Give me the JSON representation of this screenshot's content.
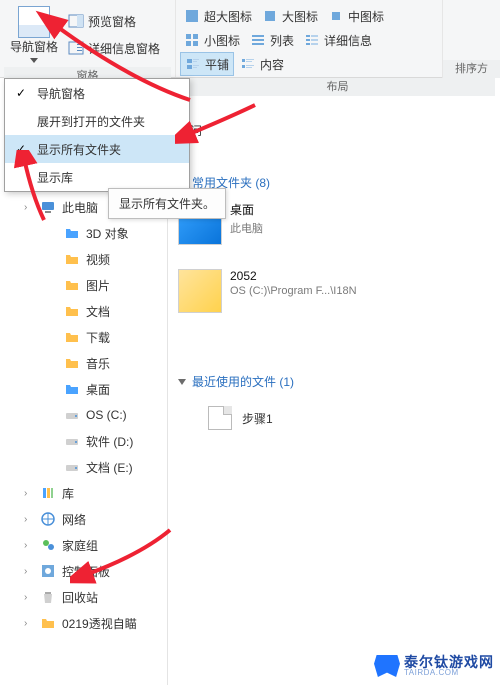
{
  "ribbon": {
    "nav_pane_btn": "导航窗格",
    "preview_pane": "预览窗格",
    "details_pane": "详细信息窗格",
    "panes_group_title": "窗格",
    "layout_group_title": "布局",
    "sort_group_stub": "排序方",
    "view_items": {
      "extra_large": "超大图标",
      "large": "大图标",
      "medium": "中图标",
      "small": "小图标",
      "list": "列表",
      "details": "详细信息",
      "tiles": "平铺",
      "content": "内容"
    }
  },
  "nav_menu": {
    "items": [
      {
        "label": "导航窗格",
        "checked": true
      },
      {
        "label": "展开到打开的文件夹",
        "checked": false
      },
      {
        "label": "显示所有文件夹",
        "checked": true,
        "hover": true
      },
      {
        "label": "显示库",
        "checked": false
      }
    ]
  },
  "tooltip_text": "显示所有文件夹。",
  "quick_access_label": "访问",
  "tree": [
    {
      "label": "此电脑",
      "depth": 1,
      "icon": "pc"
    },
    {
      "label": "3D 对象",
      "depth": 2,
      "icon": "folder-blue"
    },
    {
      "label": "视频",
      "depth": 2,
      "icon": "folder-orange"
    },
    {
      "label": "图片",
      "depth": 2,
      "icon": "folder-orange"
    },
    {
      "label": "文档",
      "depth": 2,
      "icon": "folder-orange"
    },
    {
      "label": "下载",
      "depth": 2,
      "icon": "folder-orange"
    },
    {
      "label": "音乐",
      "depth": 2,
      "icon": "folder-orange"
    },
    {
      "label": "桌面",
      "depth": 2,
      "icon": "folder-blue"
    },
    {
      "label": "OS (C:)",
      "depth": 2,
      "icon": "drive"
    },
    {
      "label": "软件 (D:)",
      "depth": 2,
      "icon": "drive"
    },
    {
      "label": "文档 (E:)",
      "depth": 2,
      "icon": "drive"
    },
    {
      "label": "库",
      "depth": 1,
      "icon": "library"
    },
    {
      "label": "网络",
      "depth": 1,
      "icon": "network"
    },
    {
      "label": "家庭组",
      "depth": 1,
      "icon": "homegroup"
    },
    {
      "label": "控制面板",
      "depth": 1,
      "icon": "control"
    },
    {
      "label": "回收站",
      "depth": 1,
      "icon": "recycle"
    },
    {
      "label": "0219透视自瞄",
      "depth": 1,
      "icon": "folder-orange"
    }
  ],
  "content": {
    "section_frequent": "常用文件夹 (8)",
    "section_recent": "最近使用的文件 (1)",
    "frequent_items": [
      {
        "name": "桌面",
        "sub": "此电脑",
        "thumb": "blue"
      },
      {
        "name": "2052",
        "sub": "OS (C:)\\Program F...\\I18N",
        "thumb": "folder"
      }
    ],
    "recent_items": [
      {
        "name": "步骤1"
      }
    ]
  },
  "watermark": {
    "cn": "泰尔钛游戏网",
    "en": "TAIRDA.COM"
  }
}
